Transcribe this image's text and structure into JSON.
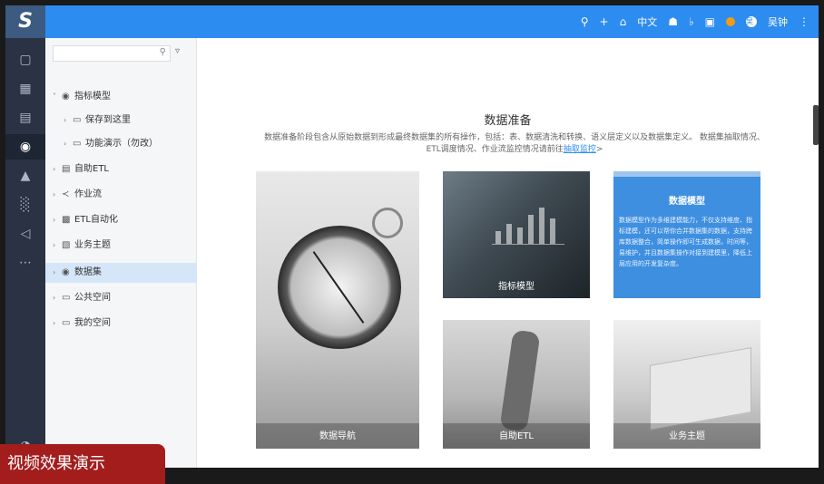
{
  "app": {
    "logo_text": "S"
  },
  "topbar": {
    "icons": [
      "search-icon",
      "plus-icon",
      "home-icon",
      "language-toggle",
      "lock-icon",
      "bell-icon",
      "printer-icon",
      "notification-icon",
      "user-avatar",
      "more-icon"
    ],
    "language_label": "中文",
    "avatar_text": "吴",
    "user_name": "吴钟"
  },
  "rail": {
    "icons": [
      "monitor-icon",
      "dashboard-icon",
      "database-icon",
      "dataset-icon",
      "chart-tool-icon",
      "report-icon",
      "send-icon",
      "more-icon",
      "settings-icon"
    ],
    "active_index": 3
  },
  "tree": {
    "search_placeholder": "",
    "nodes": [
      {
        "label": "指标模型",
        "level": 0,
        "expanded": true,
        "icon": "model-icon"
      },
      {
        "label": "保存到这里",
        "level": 1,
        "expanded": false,
        "icon": "folder-icon"
      },
      {
        "label": "功能演示（勿改）",
        "level": 1,
        "expanded": false,
        "icon": "folder-icon"
      },
      {
        "label": "自助ETL",
        "level": 0,
        "expanded": false,
        "icon": "etl-icon"
      },
      {
        "label": "作业流",
        "level": 0,
        "expanded": false,
        "icon": "flow-icon"
      },
      {
        "label": "ETL自动化",
        "level": 0,
        "expanded": false,
        "icon": "automation-icon"
      },
      {
        "label": "业务主题",
        "level": 0,
        "expanded": false,
        "icon": "theme-icon"
      },
      {
        "label": "数据集",
        "level": 0,
        "expanded": false,
        "icon": "dataset-icon",
        "selected": true
      },
      {
        "label": "公共空间",
        "level": 0,
        "expanded": false,
        "icon": "folder-icon"
      },
      {
        "label": "我的空间",
        "level": 0,
        "expanded": false,
        "icon": "private-folder-icon"
      }
    ]
  },
  "main": {
    "title": "数据准备",
    "description_1": "数据准备阶段包含从原始数据到形成最终数据集的所有操作，包括：表、数据清洗和转换、语义层定义以及数据集定义。 数据集抽取情况、",
    "description_2": "ETL调度情况、作业流监控情况请前往",
    "link_text": "抽取监控",
    "link_suffix": ">",
    "cards": {
      "data_nav": "数据导航",
      "metric_model": "指标模型",
      "data_model_title": "数据模型",
      "data_model_text": "数据模型作为多维建模能力，不仅支持维度、指标建模，还可以帮你合并数据集的数据，支持跨库数据整合，简单操作即可生成数据，时间等，易维护，并且数据集操作对接到建模里，降低上层应用的开发复杂度。",
      "self_etl": "自助ETL",
      "business_theme": "业务主题"
    }
  },
  "caption": "视频效果演示"
}
